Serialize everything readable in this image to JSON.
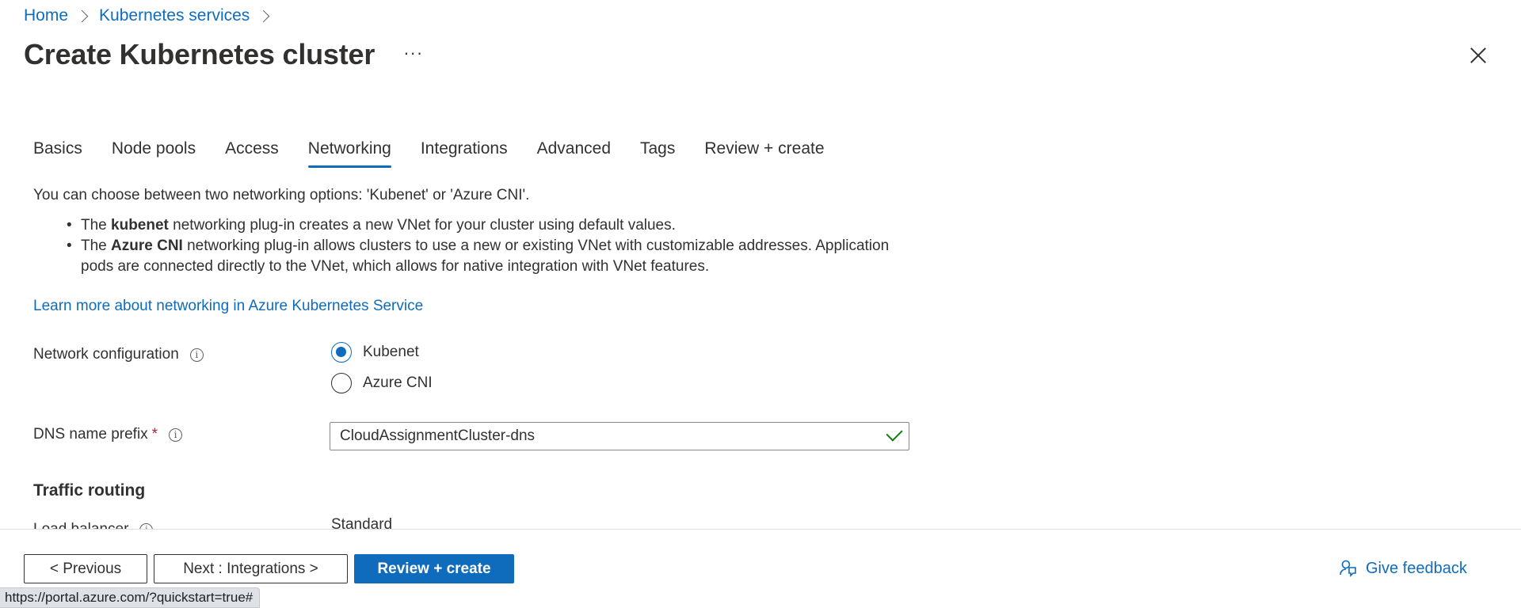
{
  "breadcrumb": {
    "home": "Home",
    "services": "Kubernetes services"
  },
  "header": {
    "title": "Create Kubernetes cluster",
    "more": "···"
  },
  "tabs": [
    {
      "label": "Basics"
    },
    {
      "label": "Node pools"
    },
    {
      "label": "Access"
    },
    {
      "label": "Networking",
      "active": true
    },
    {
      "label": "Integrations"
    },
    {
      "label": "Advanced"
    },
    {
      "label": "Tags"
    },
    {
      "label": "Review + create"
    }
  ],
  "networking": {
    "intro": "You can choose between two networking options: 'Kubenet' or 'Azure CNI'.",
    "bullet1": {
      "prefix": "The ",
      "bold": "kubenet",
      "rest": " networking plug-in creates a new VNet for your cluster using default values."
    },
    "bullet2": {
      "prefix": "The ",
      "bold": "Azure CNI",
      "rest": " networking plug-in allows clusters to use a new or existing VNet with customizable addresses. Application pods are connected directly to the VNet, which allows for native integration with VNet features."
    },
    "learn_more": "Learn more about networking in Azure Kubernetes Service",
    "network_config": {
      "label": "Network configuration",
      "options": [
        "Kubenet",
        "Azure CNI"
      ],
      "selected": "Kubenet"
    },
    "dns": {
      "label": "DNS name prefix",
      "required_mark": "*",
      "value": "CloudAssignmentCluster-dns"
    },
    "traffic_heading": "Traffic routing",
    "load_balancer": {
      "label": "Load balancer",
      "value": "Standard"
    }
  },
  "footer": {
    "previous": "< Previous",
    "next": "Next : Integrations >",
    "review": "Review + create",
    "feedback": "Give feedback"
  },
  "status_url": "https://portal.azure.com/?quickstart=true#",
  "colors": {
    "accent": "#0f6cbd",
    "success": "#107c10",
    "required": "#a4262c"
  }
}
